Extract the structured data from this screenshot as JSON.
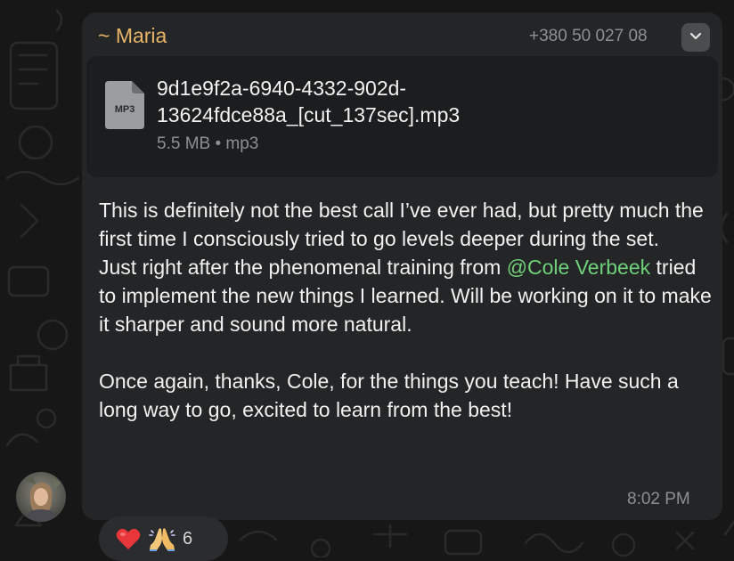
{
  "message": {
    "sender": "~ Maria",
    "phone": "+380 50 027 08",
    "attachment": {
      "icon": "file-mp3-icon",
      "badge": "MP3",
      "name": "9d1e9f2a-6940-4332-902d-13624fdce88a_[cut_137sec].mp3",
      "meta": "5.5 MB • mp3"
    },
    "body": {
      "p1_a": "This is definitely not the best call I’ve ever had, but pretty much the first time I consciously tried to go levels deeper during the set.",
      "p1_b_before": "Just right after the phenomenal training from ",
      "mention": "@Cole Verbeek",
      "p1_b_after": " tried to implement the new things I learned. Will be working on it to make it sharper and sound more natural.",
      "p2": "Once again, thanks, Cole, for the things you teach! Have such a long way to go, excited to learn from the best!"
    },
    "time": "8:02 PM",
    "reactions": {
      "emojis": [
        "red-heart",
        "folded-hands"
      ],
      "count": "6"
    }
  },
  "colors": {
    "background": "#171717",
    "bubble": "#242526",
    "file_card": "#1c1d1e",
    "sender": "#e6b368",
    "mention": "#6fd17a",
    "text": "#f1f1f1",
    "meta": "#8d8f92"
  }
}
